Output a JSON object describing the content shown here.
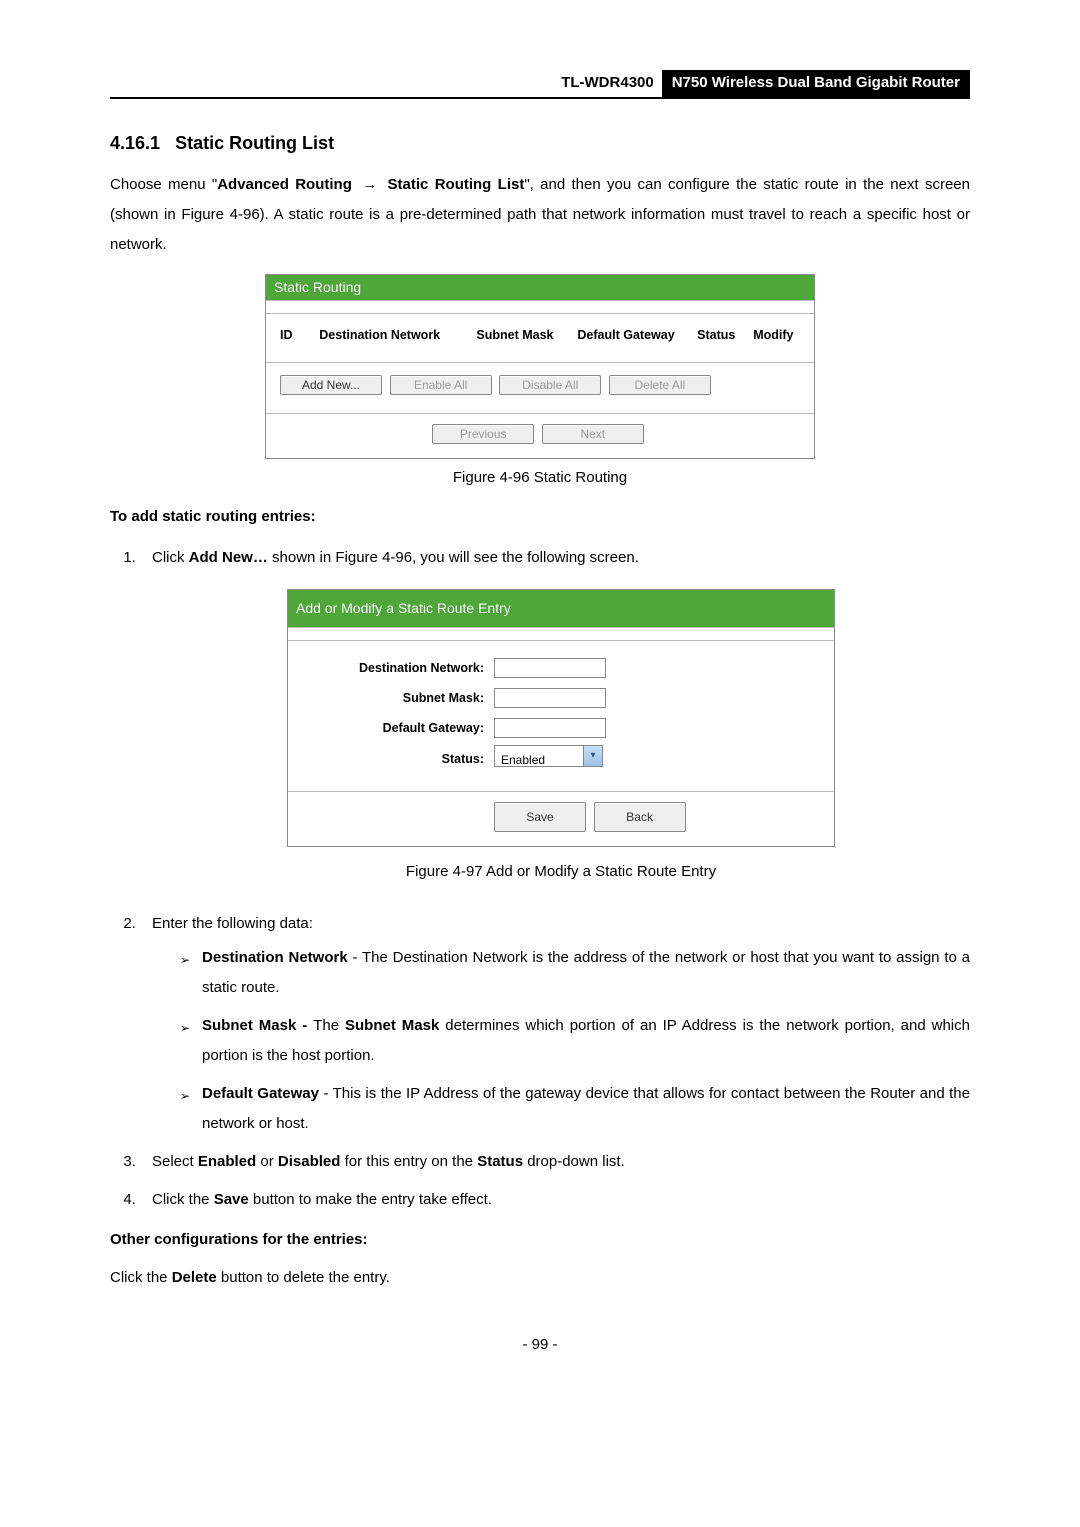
{
  "header": {
    "model": "TL-WDR4300",
    "product": "N750 Wireless Dual Band Gigabit Router"
  },
  "section": {
    "number": "4.16.1",
    "title": "Static Routing List"
  },
  "intro": {
    "pre": "Choose menu \"",
    "menu1": "Advanced Routing",
    "menu2": "Static Routing List",
    "post": "\", and then you can configure the static route in the next screen (shown in Figure 4-96). A static route is a pre-determined path that network information must travel to reach a specific host or network."
  },
  "figure96": {
    "bar_title": "Static Routing",
    "columns": [
      "ID",
      "Destination Network",
      "Subnet Mask",
      "Default Gateway",
      "Status",
      "Modify"
    ],
    "buttons_row1": [
      "Add New...",
      "Enable All",
      "Disable All",
      "Delete All"
    ],
    "buttons_row2": [
      "Previous",
      "Next"
    ],
    "caption": "Figure 4-96 Static Routing"
  },
  "to_add_heading": "To add static routing entries:",
  "step1": {
    "pre": "Click ",
    "bold": "Add New…",
    "post": " shown in Figure 4-96, you will see the following screen."
  },
  "figure97": {
    "bar_title": "Add or Modify a Static Route Entry",
    "labels": {
      "dest": "Destination Network:",
      "mask": "Subnet Mask:",
      "gw": "Default Gateway:",
      "status": "Status:"
    },
    "status_value": "Enabled",
    "buttons": [
      "Save",
      "Back"
    ],
    "caption": "Figure 4-97 Add or Modify a Static Route Entry"
  },
  "step2": {
    "intro": "Enter the following data:"
  },
  "bullets": {
    "dest": {
      "label": "Destination Network",
      "text": " - The Destination Network is the address of the network or host that you want to assign to a static route."
    },
    "mask": {
      "label": "Subnet Mask - ",
      "mid1": "The ",
      "bold2": "Subnet Mask",
      "rest": " determines which portion of an IP Address is the network portion, and which portion is the host portion."
    },
    "gw": {
      "label": "Default Gateway",
      "text": " - This is the IP Address of the gateway device that allows for contact between the Router and the network or host."
    }
  },
  "step3": {
    "t1": "Select ",
    "b1": "Enabled",
    "t2": " or ",
    "b2": "Disabled",
    "t3": " for this entry on the ",
    "b3": "Status",
    "t4": " drop-down list."
  },
  "step4": {
    "t1": "Click the ",
    "b1": "Save",
    "t2": " button to make the entry take effect."
  },
  "other_heading": "Other configurations for the entries:",
  "other_line": {
    "t1": "Click the ",
    "b1": "Delete",
    "t2": " button to delete the entry."
  },
  "page_number": "- 99 -"
}
